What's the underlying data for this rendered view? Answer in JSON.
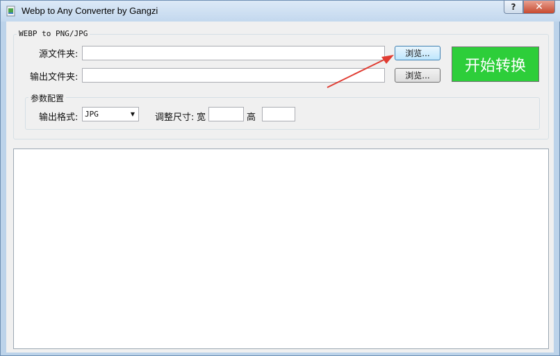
{
  "window": {
    "title": "Webp to Any Converter by Gangzi"
  },
  "titlebar": {
    "help_label": "?",
    "close_label": "✕"
  },
  "group_main": {
    "title": "WEBP to PNG/JPG",
    "source_label": "源文件夹:",
    "source_value": "",
    "output_label": "输出文件夹:",
    "output_value": "",
    "browse_label": "浏览...",
    "start_label": "开始转换"
  },
  "group_params": {
    "title": "参数配置",
    "format_label": "输出格式:",
    "format_value": "JPG",
    "resize_label": "调整尺寸:",
    "width_label": "宽",
    "width_value": "",
    "height_label": "高",
    "height_value": ""
  },
  "colors": {
    "start_button": "#2dce3a",
    "arrow": "#e03c32"
  },
  "icons": {
    "app": "image-file-icon",
    "combo": "dropdown-arrow-icon"
  }
}
